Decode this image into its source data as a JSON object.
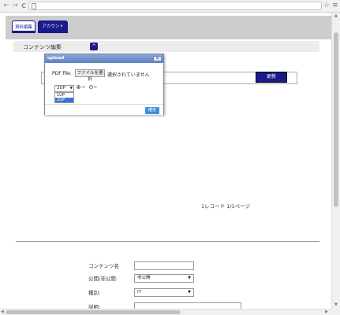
{
  "browser": {
    "back_icon": "←",
    "forward_icon": "→",
    "reload_icon": "C",
    "star_icon": "☆",
    "menu_icon": "≡"
  },
  "tabs": [
    {
      "label": "資料編集",
      "active": true
    },
    {
      "label": "アカウント",
      "active": false
    }
  ],
  "section": {
    "title": "コンテンツ編集",
    "toggle_icon": "^"
  },
  "update_button": "更新",
  "record_info": "1レコード 1/1ページ",
  "form": {
    "content_name_label": "コンテンツ名",
    "visibility_label": "公開/非公開:",
    "visibility_value": "非公開",
    "type_label": "種別:",
    "type_value": "IT",
    "description_label": "説明:"
  },
  "dialog": {
    "title": "upload",
    "close_label": "x",
    "pdf_label": "PDF file:",
    "file_button": "ファイルを選択",
    "file_status": "選択されていません",
    "layout_selected": "2UP",
    "layout_options": [
      "1UP",
      "2UP"
    ],
    "highlighted_option": "2UP",
    "radio_right": "→",
    "radio_left": "←",
    "confirm_button": "確定"
  }
}
